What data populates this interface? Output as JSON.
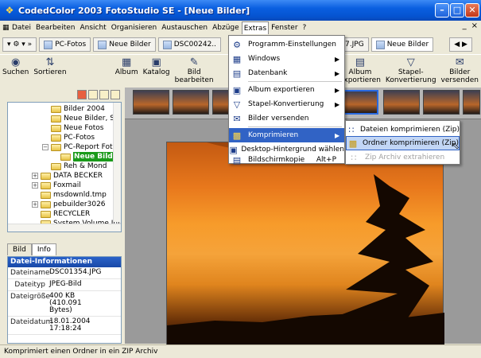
{
  "window": {
    "title": "CodedColor 2003 FotoStudio SE - [Neue Bilder]"
  },
  "menubar": [
    "Datei",
    "Bearbeiten",
    "Ansicht",
    "Organisieren",
    "Austauschen",
    "Abzüge",
    "Extras",
    "Fenster",
    "?"
  ],
  "menubar_right": [
    "_",
    "×"
  ],
  "doc_tabs": [
    "PC-Fotos",
    "Neue Bilder",
    "DSC00242..",
    "7.JPG",
    "Neue Bilder"
  ],
  "toolbar": {
    "left": [
      {
        "label": "Suchen",
        "icon": "binoculars-icon"
      },
      {
        "label": "Sortieren",
        "icon": "sort-icon"
      },
      {
        "label": "Album",
        "icon": "album-icon"
      },
      {
        "label": "Katalog",
        "icon": "catalog-icon"
      },
      {
        "label": "Bild\nbearbeiten",
        "icon": "edit-image-icon"
      }
    ],
    "right": [
      {
        "label": "Album\nexportieren",
        "icon": "export-icon"
      },
      {
        "label": "Stapel-\nKonvertierung",
        "icon": "funnel-icon"
      },
      {
        "label": "Bilder\nversenden",
        "icon": "send-icon"
      }
    ]
  },
  "tree": [
    {
      "label": "Bilder 2004",
      "level": 3
    },
    {
      "label": "Neue Bilder, Sep",
      "level": 3
    },
    {
      "label": "Neue Fotos",
      "level": 3
    },
    {
      "label": "PC-Fotos",
      "level": 3
    },
    {
      "label": "PC-Report Fotos",
      "level": 3
    },
    {
      "label": "Neue Bilde",
      "level": 4,
      "selected": true
    },
    {
      "label": "Reh & Mond",
      "level": 3
    },
    {
      "label": "DATA BECKER",
      "level": 1
    },
    {
      "label": "Foxmail",
      "level": 1
    },
    {
      "label": "msdownld.tmp",
      "level": 1
    },
    {
      "label": "pebuilder3026",
      "level": 1
    },
    {
      "label": "RECYCLER",
      "level": 1
    },
    {
      "label": "System Volume Inforr",
      "level": 1
    }
  ],
  "info_tabs": [
    "Bild",
    "Info"
  ],
  "info": {
    "header": "Datei-Informationen",
    "rows": [
      {
        "key": "Dateiname",
        "value": "DSC01354.JPG"
      },
      {
        "key": "Dateityp",
        "value": "JPEG-Bild"
      },
      {
        "key": "Dateigröße",
        "value": "400 KB\n(410.091\nBytes)"
      },
      {
        "key": "Dateidatum",
        "value": "18.01.2004\n17:18:24"
      }
    ]
  },
  "extras_menu": [
    {
      "label": "Programm-Einstellungen",
      "icon": "settings-icon"
    },
    {
      "label": "Windows",
      "icon": "windows-icon",
      "submenu": true
    },
    {
      "label": "Datenbank",
      "icon": "database-icon",
      "submenu": true
    },
    {
      "label": "Album exportieren",
      "icon": "album-export-icon",
      "submenu": true
    },
    {
      "label": "Stapel-Konvertierung",
      "icon": "funnel-icon",
      "submenu": true
    },
    {
      "label": "Bilder versenden",
      "icon": "mail-icon"
    },
    {
      "label": "Komprimieren",
      "icon": "compress-icon",
      "submenu": true,
      "highlighted": true
    },
    {
      "label": "Desktop-Hintergrund wählen",
      "icon": "desktop-icon"
    },
    {
      "label": "Bildschirmkopie",
      "icon": "screenshot-icon",
      "shortcut": "Alt+P"
    }
  ],
  "compress_submenu": [
    {
      "label": "Dateien komprimieren (Zip)",
      "icon": "zip-files-icon",
      "enabled": true
    },
    {
      "label": "Ordner komprimieren (Zip)",
      "icon": "zip-folder-icon",
      "enabled": true,
      "hovered": true
    },
    {
      "label": "Zip Archiv extrahieren",
      "icon": "zip-extract-icon",
      "enabled": false
    }
  ],
  "status": "Komprimiert einen Ordner in ein ZIP Archiv"
}
